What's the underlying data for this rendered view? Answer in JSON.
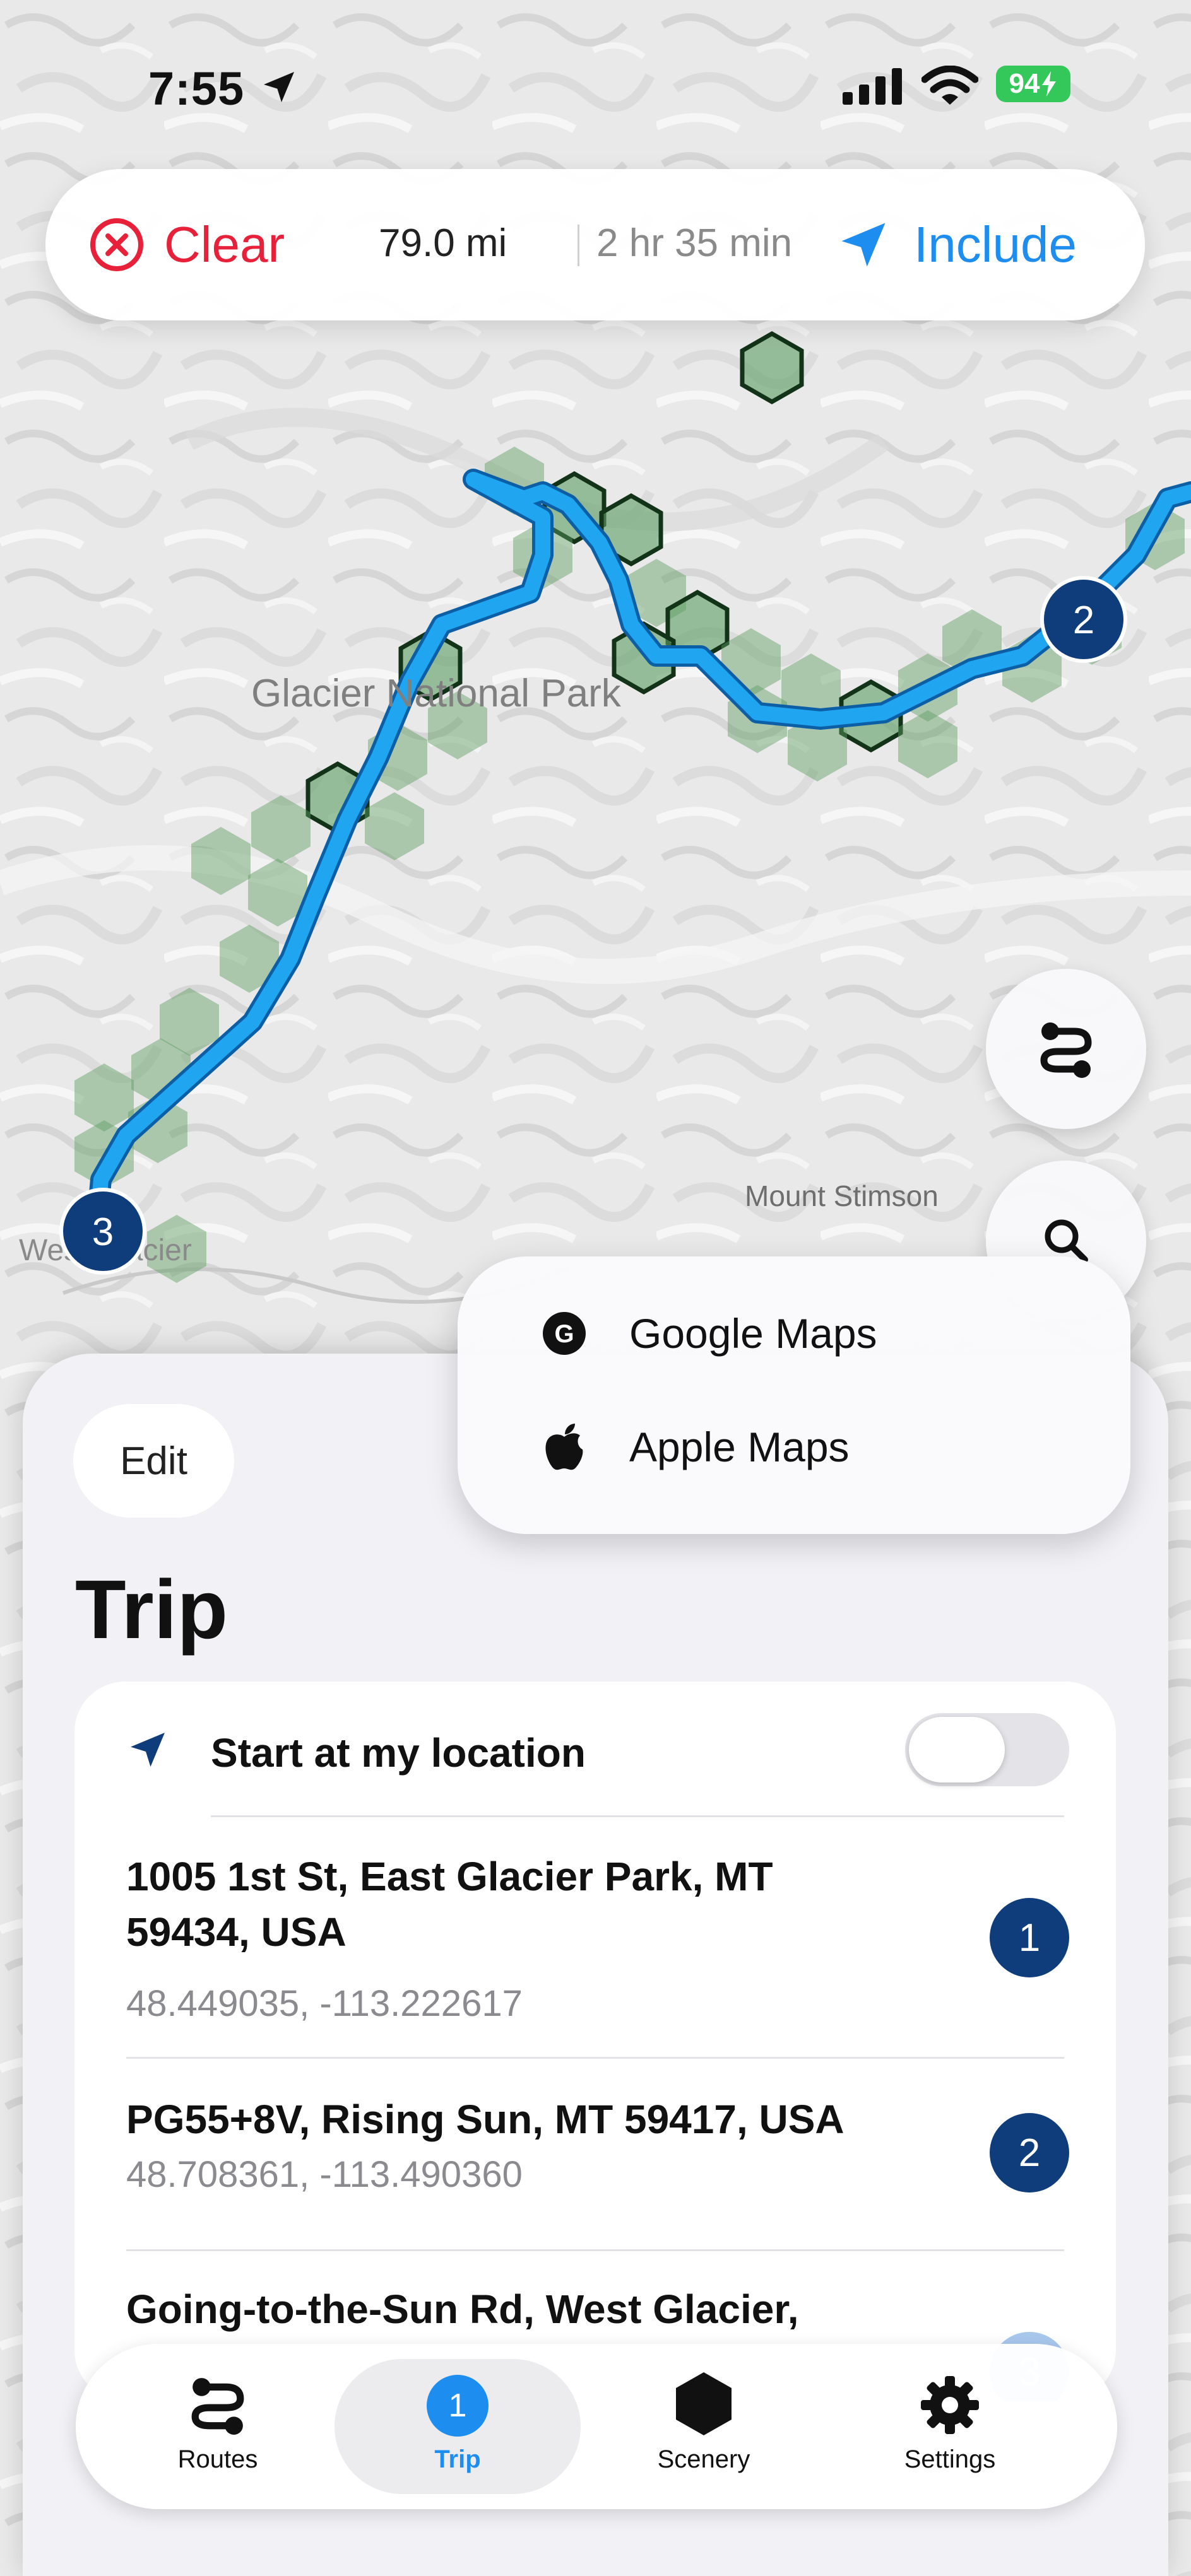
{
  "status_bar": {
    "time": "7:55",
    "battery": "94"
  },
  "top_bar": {
    "clear_label": "Clear",
    "distance": "79.0 mi",
    "duration": "2 hr 35 min",
    "include_label": "Include"
  },
  "map": {
    "labels": {
      "park": "Glacier National Park",
      "mountain": "Mount Stimson",
      "town": "West Glacier"
    },
    "markers": [
      "2",
      "3"
    ]
  },
  "nav_menu": {
    "items": [
      {
        "label": "Google Maps",
        "icon": "google-icon"
      },
      {
        "label": "Apple Maps",
        "icon": "apple-icon"
      }
    ]
  },
  "sheet": {
    "edit_label": "Edit",
    "title": "Trip",
    "start_row": {
      "label": "Start at my location",
      "toggle_on": false
    },
    "stops": [
      {
        "address_line1": "1005 1st St, East Glacier Park, MT",
        "address_line2": "59434, USA",
        "coords": "48.449035, -113.222617",
        "number": "1"
      },
      {
        "address_line1": "PG55+8V, Rising Sun, MT 59417, USA",
        "address_line2": "",
        "coords": "48.708361, -113.490360",
        "number": "2"
      },
      {
        "address_line1": "Going-to-the-Sun Rd, West Glacier,",
        "address_line2": "",
        "coords": "",
        "number": "3"
      }
    ]
  },
  "tab_bar": {
    "tabs": [
      {
        "label": "Routes",
        "icon": "routes-icon"
      },
      {
        "label": "Trip",
        "badge": "1",
        "active": true
      },
      {
        "label": "Scenery",
        "icon": "hexagon-icon"
      },
      {
        "label": "Settings",
        "icon": "gear-icon"
      }
    ]
  },
  "colors": {
    "route": "#1fa3ef",
    "marker": "#0f3d7c",
    "hex_fill": "#5e9e62",
    "accent": "#1d8ef0",
    "danger": "#e8213a"
  }
}
